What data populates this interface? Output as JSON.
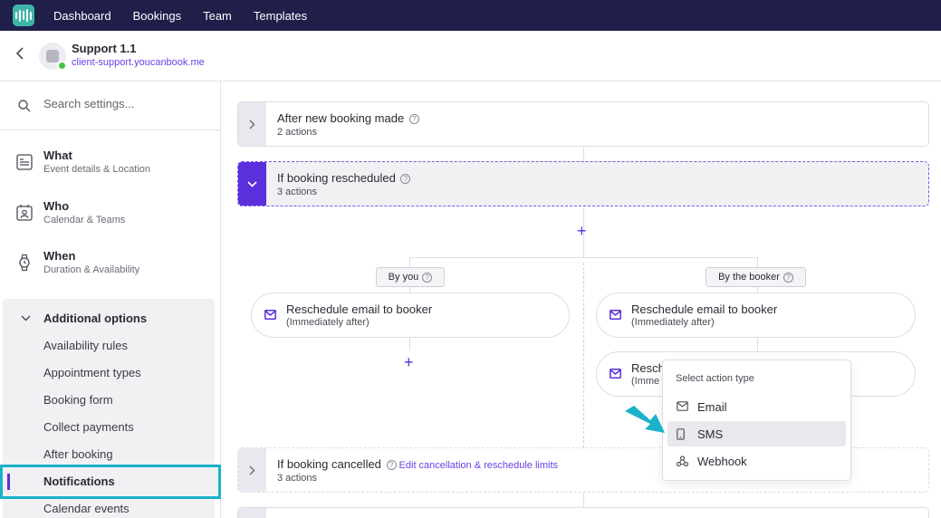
{
  "nav": {
    "items": [
      "Dashboard",
      "Bookings",
      "Team",
      "Templates"
    ]
  },
  "header": {
    "title": "Support 1.1",
    "url": "client-support.youcanbook.me"
  },
  "sidebar": {
    "search_placeholder": "Search settings...",
    "sections": [
      {
        "title": "What",
        "subtitle": "Event details & Location"
      },
      {
        "title": "Who",
        "subtitle": "Calendar & Teams"
      },
      {
        "title": "When",
        "subtitle": "Duration & Availability"
      }
    ],
    "additional": {
      "title": "Additional options",
      "items": [
        "Availability rules",
        "Appointment types",
        "Booking form",
        "Collect payments",
        "After booking",
        "Notifications",
        "Calendar events"
      ],
      "active": "Notifications"
    }
  },
  "workflow": {
    "after_new": {
      "title": "After new booking made",
      "subtitle": "2 actions"
    },
    "rescheduled": {
      "title": "If booking rescheduled",
      "subtitle": "3 actions"
    },
    "by_you": "By you",
    "by_booker": "By the booker",
    "left_step": {
      "title": "Reschedule email to booker",
      "subtitle": "(Immediately after)"
    },
    "right_step1": {
      "title": "Reschedule email to booker",
      "subtitle": "(Immediately after)"
    },
    "right_step2": {
      "title": "Resch",
      "subtitle": "(Imme"
    },
    "cancelled": {
      "title": "If booking cancelled",
      "link": "Edit cancellation & reschedule limits",
      "subtitle": "3 actions"
    },
    "plus": "+"
  },
  "menu": {
    "header": "Select action type",
    "items": [
      {
        "label": "Email",
        "icon": "mail-icon"
      },
      {
        "label": "SMS",
        "icon": "phone-icon"
      },
      {
        "label": "Webhook",
        "icon": "webhook-icon"
      }
    ],
    "highlighted": "SMS"
  },
  "colors": {
    "accent": "#5b2fdc",
    "highlight": "#19b2c9",
    "nav_bg": "#1f1f4a"
  }
}
